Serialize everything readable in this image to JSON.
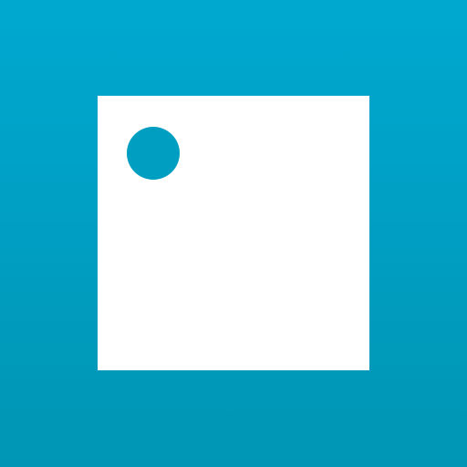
{
  "icon": {
    "name": "app-icon",
    "colors": {
      "background_top": "#00a8d0",
      "background_bottom": "#0095b4",
      "square": "#ffffff",
      "dot": "#009fc1"
    },
    "shapes": [
      "white-square",
      "dot"
    ]
  }
}
